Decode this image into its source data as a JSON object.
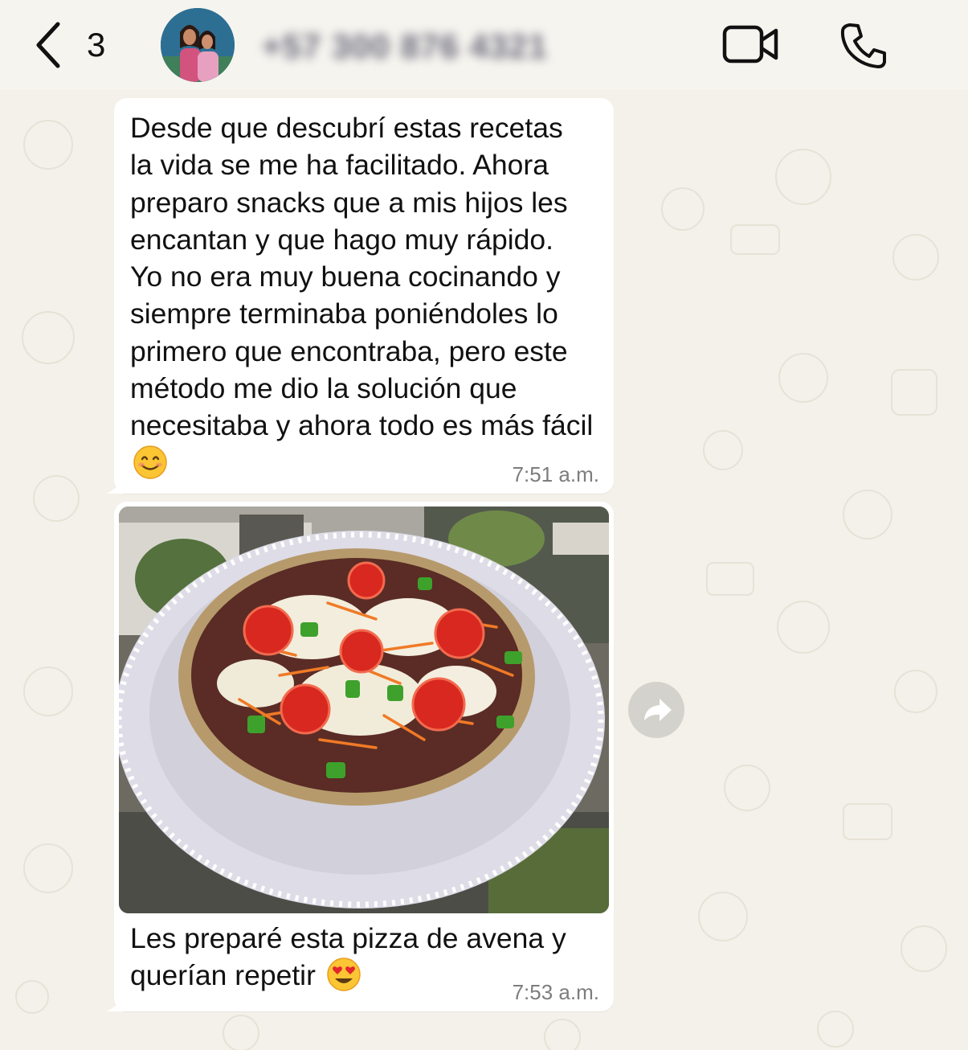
{
  "header": {
    "unread_count": "3",
    "contact_name": "+57 300 876 4321",
    "icons": {
      "back": "chevron-left-icon",
      "video": "video-camera-icon",
      "call": "phone-icon"
    }
  },
  "messages": [
    {
      "text": "Desde que descubrí estas recetas\nla vida se me ha facilitado. Ahora\npreparo snacks que a mis hijos les\nencantan y que hago muy rápido.\nYo no era muy buena cocinando y\nsiempre terminaba poniéndoles lo\nprimero que encontraba, pero este\nmétodo me dio la solución que\nnecesitaba y ahora todo es más fácil",
      "emoji": "smiling-face-icon",
      "time": "7:51 a.m."
    },
    {
      "image": "pizza-photo",
      "caption": "Les preparé esta pizza de avena y\nquerían repetir",
      "emoji": "heart-eyes-icon",
      "time": "7:53 a.m."
    }
  ],
  "colors": {
    "background": "#f4f1ea",
    "bubble": "#ffffff",
    "timestamp": "#7d7d7d",
    "forward_button": "#d4d2cc"
  }
}
